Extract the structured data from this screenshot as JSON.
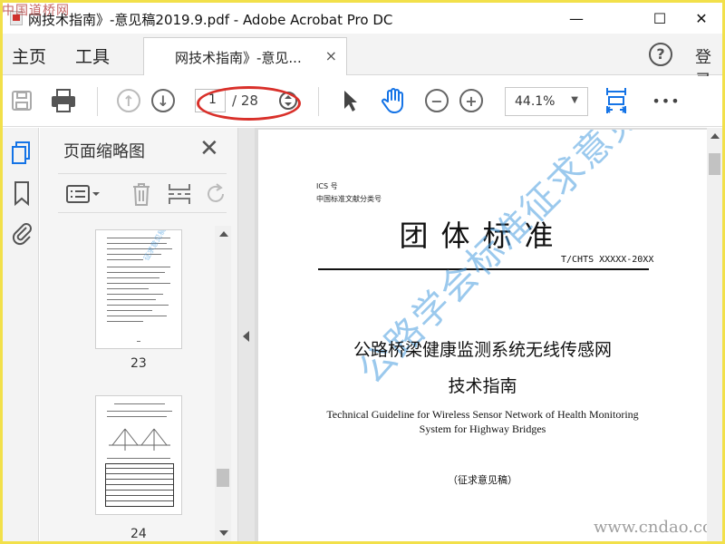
{
  "window": {
    "title": "网技术指南》-意见稿2019.9.pdf - Adobe Acrobat Pro DC",
    "watermark_top": "中国道桥网",
    "controls": [
      "—",
      "☐",
      "✕"
    ]
  },
  "menubar": {
    "home": "主页",
    "tools": "工具",
    "doc_tab": "网技术指南》-意见...",
    "doc_tab_close": "×",
    "help": "?",
    "login": "登录"
  },
  "toolbar": {
    "page_current": "1",
    "page_total": "/ 28",
    "zoom": "44.1%",
    "more": "•••"
  },
  "thumbnail_pane": {
    "title": "页面缩略图",
    "close": "✕",
    "pages": [
      {
        "number": "23"
      },
      {
        "number": "24"
      }
    ],
    "thumb_watermark": "征求意见稿"
  },
  "document": {
    "ics_line1": "ICS 号",
    "ics_line2": "中国标准文献分类号",
    "main_title": "团体标准",
    "standard_number": "T/CHTS XXXXX-20XX",
    "cn_title_line1": "公路桥梁健康监测系统无线传感网",
    "cn_title_line2": "技术指南",
    "en_title_line1": "Technical Guideline for Wireless Sensor Network of Health Monitoring",
    "en_title_line2": "System for Highway Bridges",
    "draft_label": "（征求意见稿）",
    "watermark": "公路学会标准征求意见稿",
    "site_watermark": "www.cndao.com"
  },
  "colors": {
    "frame": "#f2e04a",
    "accent_blue": "#1473e6",
    "annotation_red": "#d9302a",
    "watermark_blue": "#4a9ee0"
  }
}
